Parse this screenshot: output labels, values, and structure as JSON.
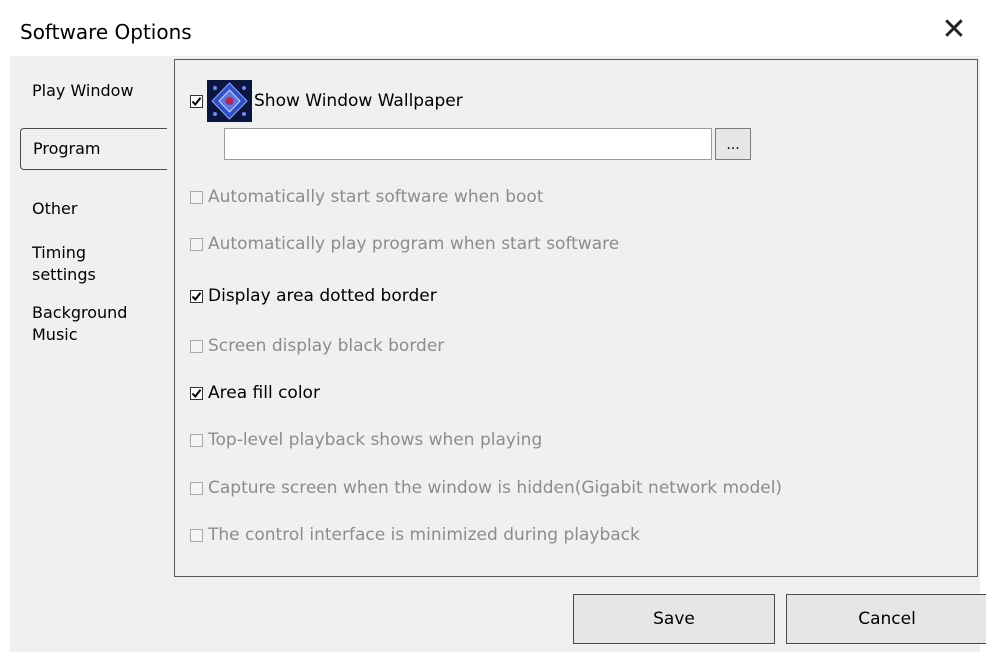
{
  "window": {
    "title": "Software Options"
  },
  "tabs": [
    {
      "label": "Play Window"
    },
    {
      "label": "Program"
    },
    {
      "label": "Other"
    },
    {
      "label": "Timing\nsettings"
    },
    {
      "label": "Background\nMusic"
    }
  ],
  "selected_tab": "Program",
  "wallpaper": {
    "label": "Show Window Wallpaper",
    "checked": true,
    "path_value": "",
    "browse_label": "..."
  },
  "options": [
    {
      "label": "Automatically start software when boot",
      "checked": false,
      "enabled": false
    },
    {
      "label": "Automatically play program when start software",
      "checked": false,
      "enabled": false
    },
    {
      "label": "Display area dotted border",
      "checked": true,
      "enabled": true
    },
    {
      "label": "Screen display black border",
      "checked": false,
      "enabled": false
    },
    {
      "label": "Area fill color",
      "checked": true,
      "enabled": true
    },
    {
      "label": "Top-level playback shows when playing",
      "checked": false,
      "enabled": false
    },
    {
      "label": "Capture screen when the window is hidden(Gigabit network model)",
      "checked": false,
      "enabled": false
    },
    {
      "label": "The control interface is minimized during playback",
      "checked": false,
      "enabled": false
    }
  ],
  "buttons": {
    "save": "Save",
    "cancel": "Cancel"
  },
  "colors": {
    "dialog_bg": "#f0f0f0",
    "disabled_text": "#8c8c8c",
    "thumb_bg": "#0c1440"
  }
}
